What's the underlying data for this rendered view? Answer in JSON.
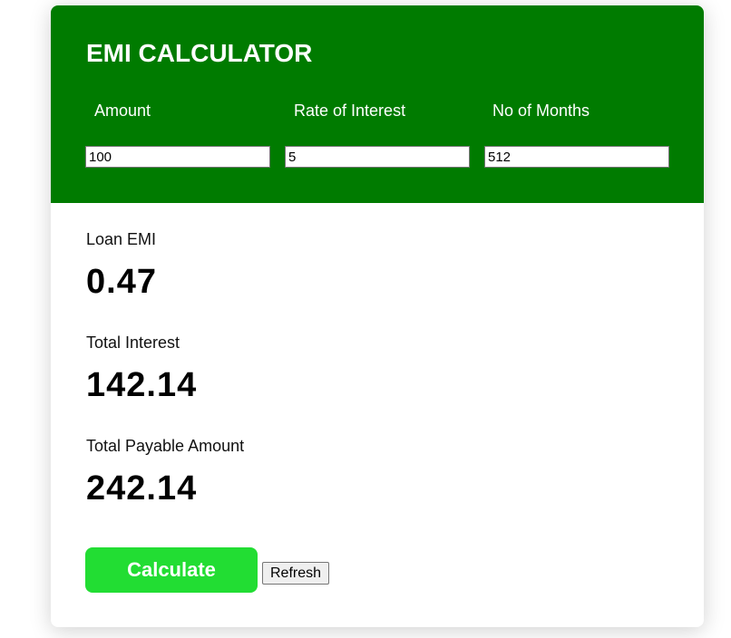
{
  "header": {
    "title": "EMI CALCULATOR",
    "accent_color": "#007b00"
  },
  "fields": {
    "amount": {
      "label": "Amount",
      "value": "100"
    },
    "rate": {
      "label": "Rate of Interest",
      "value": "5"
    },
    "months": {
      "label": "No of Months",
      "value": "512"
    }
  },
  "results": {
    "loan_emi": {
      "label": "Loan EMI",
      "value": "0.47"
    },
    "total_interest": {
      "label": "Total Interest",
      "value": "142.14"
    },
    "total_payable": {
      "label": "Total Payable Amount",
      "value": "242.14"
    }
  },
  "actions": {
    "calculate_label": "Calculate",
    "calculate_color": "#22dd33",
    "refresh_label": "Refresh"
  }
}
